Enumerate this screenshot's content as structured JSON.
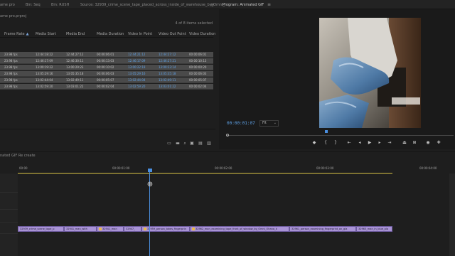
{
  "tabs": {
    "project": "ame pro",
    "bin_seq": "Bin: Seq",
    "bin_rush": "Bin: RUSH",
    "source": "Source: 32939_crime_scene_tape_placed_across_inside_of_warehouse_by_Omni_i",
    "program": "Program: Animated GIF"
  },
  "project_panel": {
    "file_name": "ame pro.prproj",
    "selection_count": "4 of 8 items selected",
    "columns": [
      "Frame Rate",
      "Media Start",
      "Media End",
      "Media Duration",
      "Video In Point",
      "Video Out Point",
      "Video Duration"
    ],
    "rows": [
      [
        "23.98 fps",
        "12:44:18:22",
        "12:44:27:12",
        "00:00:06:01",
        "12:44:21:12",
        "12:44:27:12",
        "00:00:06:01"
      ],
      [
        "23.98 fps",
        "12:46:17:09",
        "12:46:30:11",
        "00:00:13:03",
        "12:46:17:09",
        "12:46:27:21",
        "00:00:10:13"
      ],
      [
        "23.98 fps",
        "13:00:19:22",
        "13:00:29:23",
        "00:00:10:02",
        "13:00:22:19",
        "13:00:23:14",
        "00:00:00:20"
      ],
      [
        "23.98 fps",
        "13:05:29:16",
        "13:05:35:18",
        "00:00:06:03",
        "13:05:29:16",
        "13:05:35:18",
        "00:00:06:03"
      ],
      [
        "23.98 fps",
        "13:02:44:04",
        "13:02:49:11",
        "00:00:05:07",
        "13:02:44:04",
        "13:02:49:11",
        "00:00:05:07"
      ],
      [
        "23.98 fps",
        "13:02:59:20",
        "13:03:01:22",
        "00:00:02:04",
        "13:02:59:20",
        "13:03:01:22",
        "00:00:02:04"
      ]
    ]
  },
  "program_monitor": {
    "timecode": "00:00:01:07",
    "fit": "Fit",
    "playhead_fraction": 0.44
  },
  "timeline": {
    "sequence_name": "nated GIF Re create",
    "ruler_labels": [
      "00:00",
      "00:00:01:00",
      "00:00:02:00",
      "00:00:03:00",
      "00:00:04:00"
    ],
    "clips": [
      {
        "label": "32939_crime_scene_tape_p",
        "fx": false
      },
      {
        "label": "32941_man_with",
        "fx": false
      },
      {
        "label": "32941_man",
        "fx": true
      },
      {
        "label": "32947_",
        "fx": false
      },
      {
        "label": "32959_person_takes_fingerprin",
        "fx": true
      },
      {
        "label": "32962_man_examining_tape_front_of_window_by_Omni_Ohana_k",
        "fx": true
      },
      {
        "label": "32961_person_examining_fingerprint_on_gla",
        "fx": false
      },
      {
        "label": "32963_man_in_blue_pla",
        "fx": false
      }
    ]
  },
  "colors": {
    "accent_blue": "#4a8fe0",
    "timecode_blue": "#5fa2e6",
    "clip_purple": "#a993d6",
    "workarea_yellow": "#d8c244"
  }
}
